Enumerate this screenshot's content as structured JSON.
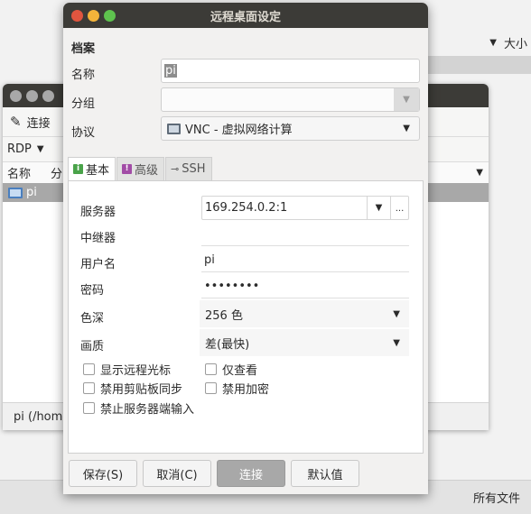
{
  "background_window": {
    "size_label": "大小",
    "all_files_label": "所有文件"
  },
  "main_window": {
    "toolbar": {
      "connect_label": "连接"
    },
    "protocol_selector": {
      "value": "RDP"
    },
    "columns": {
      "name": "名称",
      "group_partial": "分"
    },
    "rows": [
      {
        "name": "pi"
      }
    ],
    "status_text": "pi (/home"
  },
  "dialog": {
    "title": "远程桌面设定",
    "section_title": "档案",
    "name": {
      "label": "名称",
      "value": "pi"
    },
    "group": {
      "label": "分组",
      "value": ""
    },
    "protocol": {
      "label": "协议",
      "value": "VNC - 虚拟网络计算"
    },
    "tabs": [
      {
        "label": "基本",
        "icon": "info-icon"
      },
      {
        "label": "高级",
        "icon": "warning-icon"
      },
      {
        "label": "SSH",
        "icon": "key-icon"
      }
    ],
    "basic": {
      "server": {
        "label": "服务器",
        "value": "169.254.0.2:1"
      },
      "repeater": {
        "label": "中继器",
        "value": ""
      },
      "username": {
        "label": "用户名",
        "value": "pi"
      },
      "password": {
        "label": "密码",
        "value": "••••••••"
      },
      "color_depth": {
        "label": "色深",
        "value": "256 色"
      },
      "quality": {
        "label": "画质",
        "value": "差(最快)"
      }
    },
    "checkboxes": {
      "show_remote_cursor": "显示远程光标",
      "view_only": "仅查看",
      "disable_clipboard_sync": "禁用剪贴板同步",
      "disable_encryption": "禁用加密",
      "disable_server_input": "禁止服务器端输入"
    },
    "buttons": {
      "save": "保存(S)",
      "cancel": "取消(C)",
      "connect": "连接",
      "default": "默认值"
    },
    "more_glyph": "..."
  },
  "colors": {
    "titlebar": "#3c3b37",
    "close": "#e0553f",
    "minimize": "#f4b43a",
    "maximize": "#5ec24e",
    "selection": "#a8a8a8"
  }
}
